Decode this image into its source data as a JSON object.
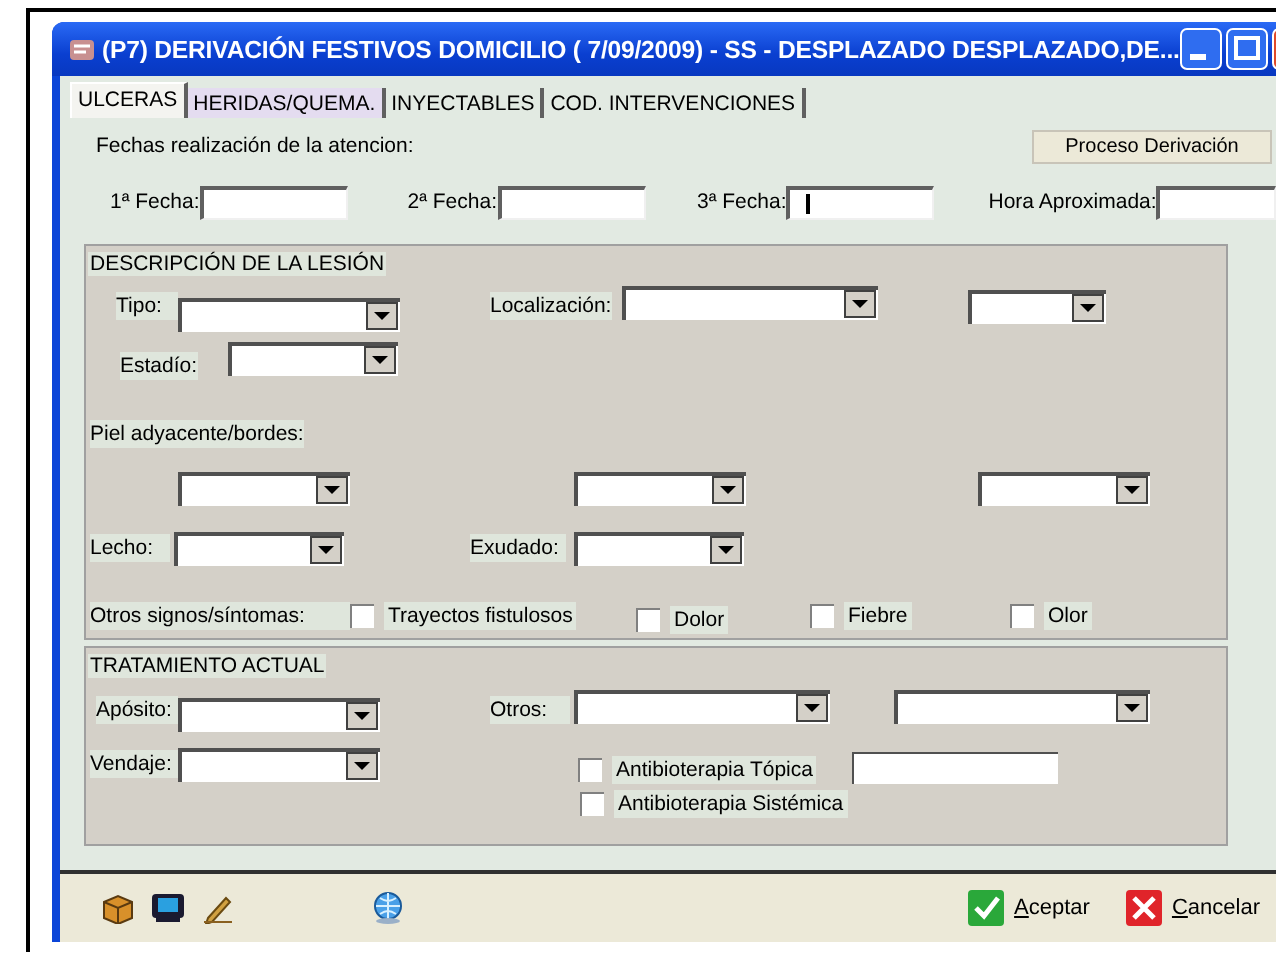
{
  "window": {
    "title": "(P7) DERIVACIÓN FESTIVOS DOMICILIO ( 7/09/2009) - SS - DESPLAZADO DESPLAZADO,DE..."
  },
  "tabs": [
    {
      "label": "ULCERAS",
      "selected": true
    },
    {
      "label": "HERIDAS/QUEMA.",
      "selected": false
    },
    {
      "label": "INYECTABLES",
      "selected": false
    },
    {
      "label": "COD. INTERVENCIONES",
      "selected": false
    }
  ],
  "dates": {
    "caption": "Fechas realización de la atencion:",
    "button": "Proceso Derivación",
    "fields": [
      {
        "label": "1ª Fecha:",
        "focused": false
      },
      {
        "label": "2ª Fecha:",
        "focused": false
      },
      {
        "label": "3ª Fecha:",
        "focused": true
      },
      {
        "label": "Hora Aproximada:",
        "focused": false
      }
    ]
  },
  "panels": [
    {
      "title": "DESCRIPCIÓN DE LA LESIÓN",
      "rows": [
        [
          {
            "kind": "label",
            "text": "Tipo:"
          },
          {
            "kind": "combo"
          },
          {
            "kind": "label",
            "text": "Localización:"
          },
          {
            "kind": "combo"
          },
          {
            "kind": "combo"
          }
        ],
        [
          {
            "kind": "label",
            "text": "Estadío:"
          },
          {
            "kind": "combo"
          }
        ],
        [
          {
            "kind": "label",
            "text": "Piel adyacente/bordes:"
          }
        ],
        [
          {
            "kind": "combo"
          },
          {
            "kind": "combo"
          },
          {
            "kind": "combo"
          }
        ],
        [
          {
            "kind": "label",
            "text": "Lecho:"
          },
          {
            "kind": "combo"
          },
          {
            "kind": "label",
            "text": "Exudado:"
          },
          {
            "kind": "combo"
          }
        ],
        [
          {
            "kind": "label",
            "text": "Otros signos/síntomas:"
          },
          {
            "kind": "checkbox",
            "label": "Trayectos fistulosos",
            "checked": false
          },
          {
            "kind": "checkbox",
            "label": "Dolor",
            "checked": false
          },
          {
            "kind": "checkbox",
            "label": "Fiebre",
            "checked": false
          },
          {
            "kind": "checkbox",
            "label": "Olor",
            "checked": false
          }
        ]
      ]
    },
    {
      "title": "TRATAMIENTO ACTUAL",
      "rows": [
        [
          {
            "kind": "label",
            "text": "Apósito:"
          },
          {
            "kind": "combo"
          },
          {
            "kind": "label",
            "text": "Otros:"
          },
          {
            "kind": "combo"
          },
          {
            "kind": "combo"
          }
        ],
        [
          {
            "kind": "label",
            "text": "Vendaje:"
          },
          {
            "kind": "combo"
          },
          {
            "kind": "checkbox",
            "label": "Antibioterapia Tópica",
            "checked": false
          },
          {
            "kind": "text"
          }
        ],
        [
          {
            "kind": "checkbox",
            "label": "Antibioterapia Sistémica",
            "checked": false
          }
        ]
      ]
    }
  ],
  "actions": [
    {
      "kind": "accept",
      "label": "Aceptar"
    },
    {
      "kind": "cancel",
      "label": "Cancelar"
    }
  ]
}
